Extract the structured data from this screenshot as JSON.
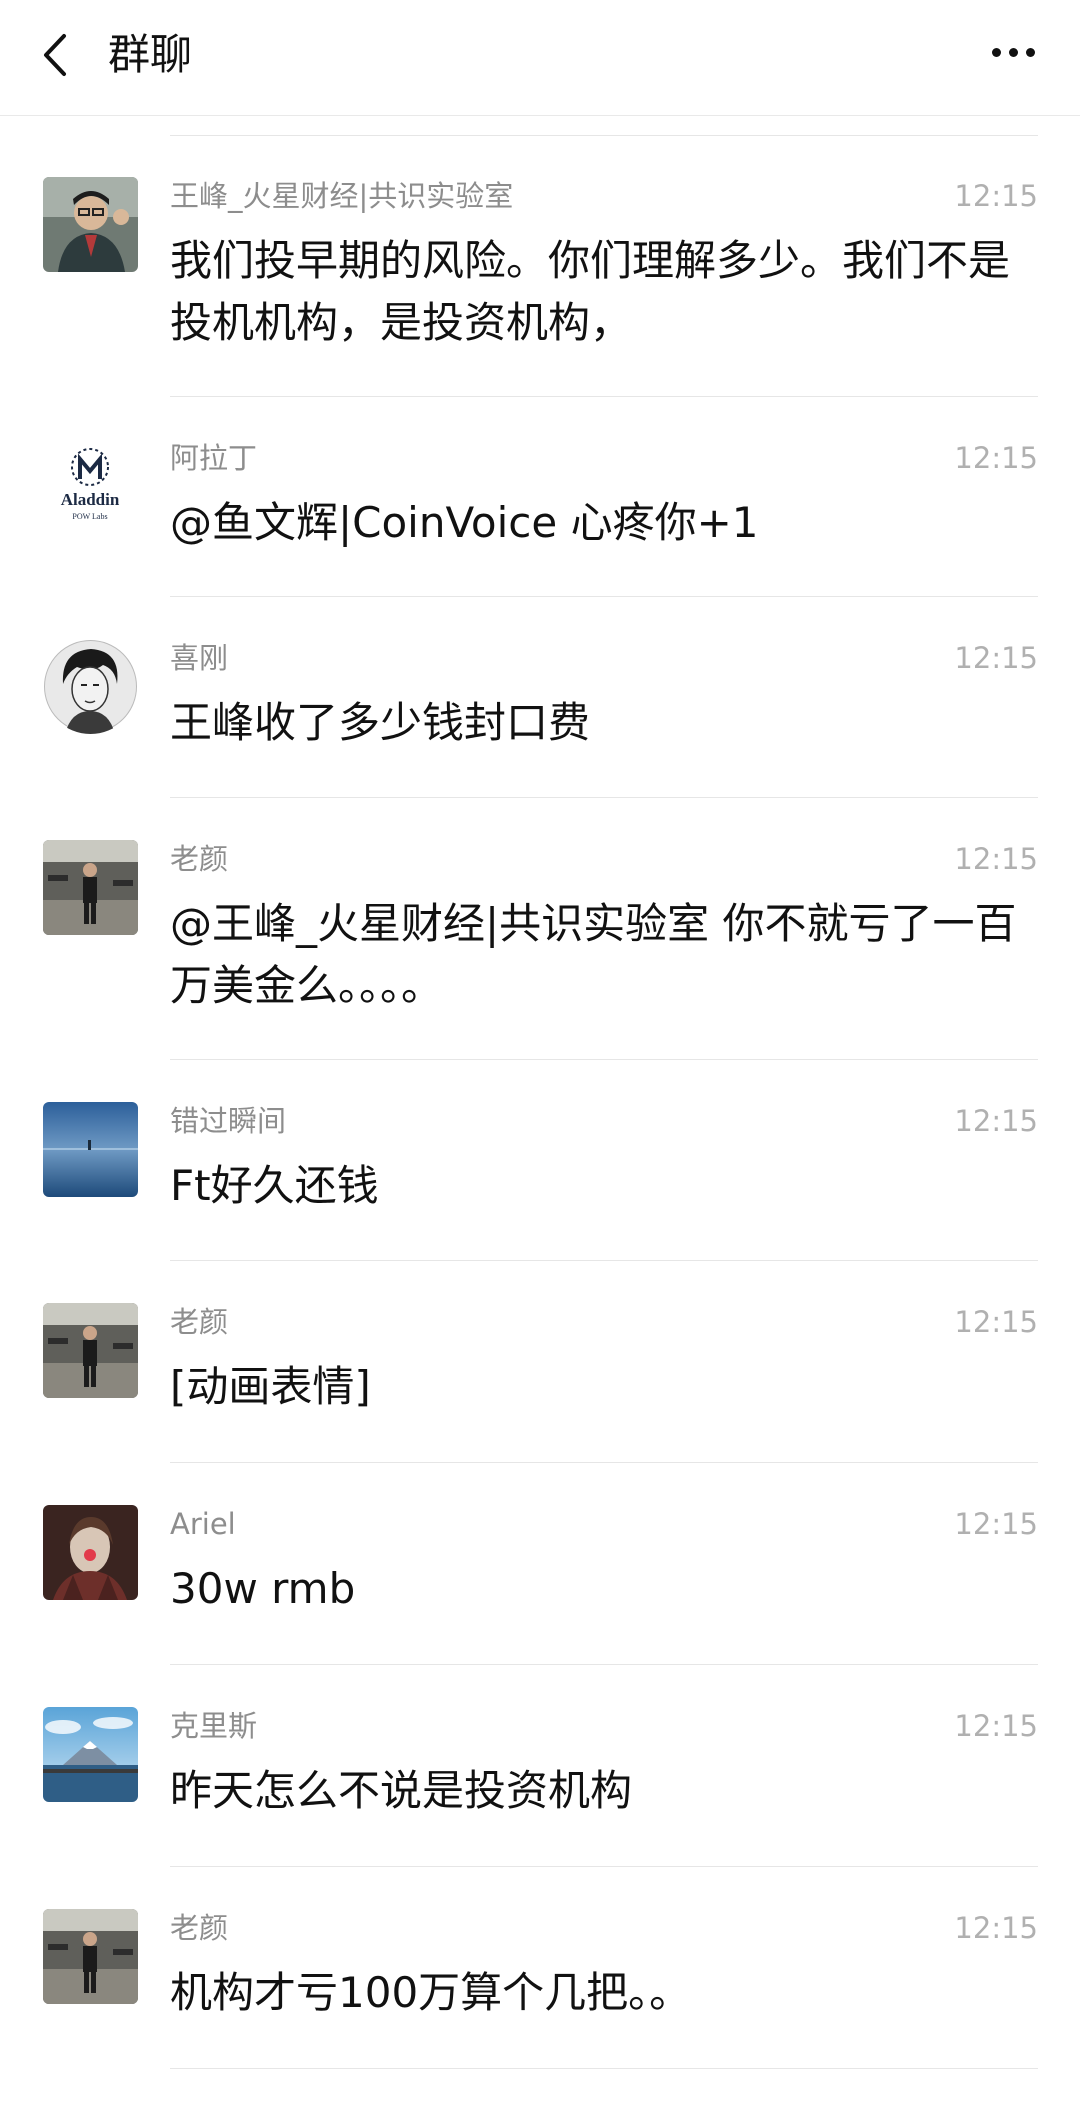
{
  "header": {
    "title": "群聊",
    "back_icon": "chevron-left-icon",
    "more_icon": "more-dots-icon"
  },
  "messages": [
    {
      "sender": "王峰_火星财经|共识实验室",
      "time": "12:15",
      "text": "我们投早期的风险。你们理解多少。我们不是投机机构，是投资机构，",
      "avatar": "photo-man-glasses"
    },
    {
      "sender": "阿拉丁",
      "time": "12:15",
      "text": "@鱼文辉|CoinVoice 心疼你+1",
      "avatar": "aladdin-logo",
      "avatar_text": "Aladdin",
      "avatar_subtext": "POW Labs"
    },
    {
      "sender": "喜刚",
      "time": "12:15",
      "text": "王峰收了多少钱封口费",
      "avatar": "sketch-portrait"
    },
    {
      "sender": "老颜",
      "time": "12:15",
      "text": "@王峰_火星财经|共识实验室 你不就亏了一百万美金么。。。。",
      "avatar": "gym-photo"
    },
    {
      "sender": "错过瞬间",
      "time": "12:15",
      "text": "Ft好久还钱",
      "avatar": "lake-photo"
    },
    {
      "sender": "老颜",
      "time": "12:15",
      "text": "[动画表情]",
      "avatar": "gym-photo"
    },
    {
      "sender": "Ariel",
      "time": "12:15",
      "text": "30w rmb",
      "avatar": "portrait-girl"
    },
    {
      "sender": "克里斯",
      "time": "12:15",
      "text": "昨天怎么不说是投资机构",
      "avatar": "mountain-photo"
    },
    {
      "sender": "老颜",
      "time": "12:15",
      "text": "机构才亏100万算个几把。。",
      "avatar": "gym-photo"
    }
  ]
}
